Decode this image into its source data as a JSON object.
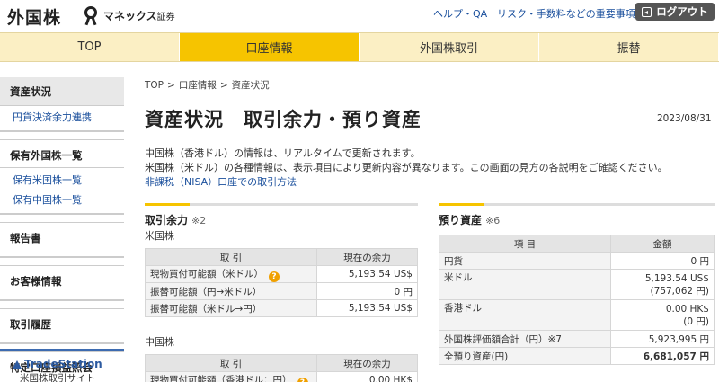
{
  "header": {
    "brand": "外国株",
    "logo_text": "マネックス",
    "logo_suffix": "証券",
    "link_help": "ヘルプ・QA",
    "link_risk": "リスク・手数料などの重要事項",
    "logout_label": "ログアウト"
  },
  "nav": {
    "tabs": [
      "TOP",
      "口座情報",
      "外国株取引",
      "振替"
    ],
    "active": "口座情報"
  },
  "sidebar": {
    "groups": [
      {
        "title": "資産状況",
        "items": [
          "円貨決済余力連携"
        ]
      },
      {
        "title": "保有外国株一覧",
        "items": [
          "保有米国株一覧",
          "保有中国株一覧"
        ]
      },
      {
        "title": "報告書",
        "items": []
      },
      {
        "title": "お客様情報",
        "items": []
      },
      {
        "title": "取引履歴",
        "items": []
      },
      {
        "title": "特定口座損益照会",
        "items": []
      }
    ],
    "banner_logo": "TradeStation",
    "banner_sub": "米国株取引サイト"
  },
  "main": {
    "breadcrumb": [
      "TOP",
      "口座情報",
      "資産状況"
    ],
    "breadcrumb_sep": ">",
    "title": "資産状況　取引余力・預り資産",
    "date": "2023/08/31",
    "desc": [
      "中国株（香港ドル）の情報は、リアルタイムで更新されます。",
      "米国株（米ドル）の各種情報は、表示項目により更新内容が異なります。この画面の見方の各説明をご確認ください。"
    ],
    "nisa_link": "非課税（NISA）口座での取引方法"
  },
  "trading_power": {
    "title": "取引余力",
    "note": "※2",
    "us_label": "米国株",
    "cn_label": "中国株",
    "col_item": "取 引",
    "col_value": "現在の余力",
    "us_rows": [
      {
        "label": "現物買付可能額（米ドル）",
        "value": "5,193.54 US$"
      },
      {
        "label": "振替可能額（円→米ドル）",
        "value": "0 円"
      },
      {
        "label": "振替可能額（米ドル→円）",
        "value": "5,193.54 US$"
      }
    ],
    "cn_rows": [
      {
        "label": "現物買付可能額（香港ドル：円）",
        "value": "0.00 HK$"
      }
    ]
  },
  "deposits": {
    "title": "預り資産",
    "note": "※6",
    "col_item": "項 目",
    "col_value": "金額",
    "rows": [
      {
        "label": "円貨",
        "value": "0 円",
        "value2": ""
      },
      {
        "label": "米ドル",
        "value": "5,193.54 US$",
        "value2": "(757,062 円)"
      },
      {
        "label": "香港ドル",
        "value": "0.00 HK$",
        "value2": "(0 円)"
      },
      {
        "label": "外国株評価額合計（円）※7",
        "value": "5,923,995 円",
        "value2": ""
      },
      {
        "label": "全預り資産(円)",
        "value": "6,681,057 円",
        "value2": ""
      }
    ]
  },
  "colors": {
    "accent": "#f6c400",
    "nav_bg": "#fbefc4",
    "link": "#1a4f9c"
  }
}
